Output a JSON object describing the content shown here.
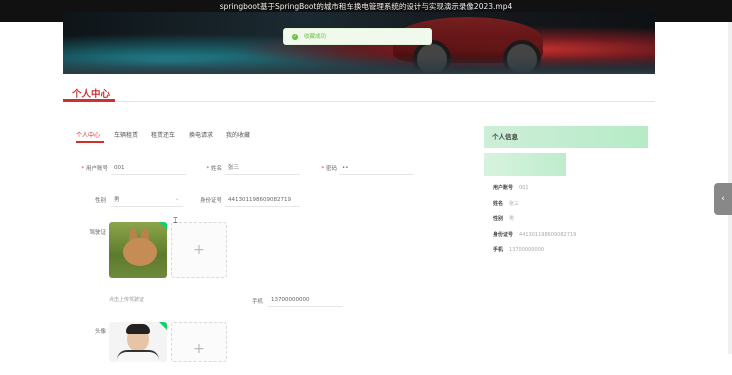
{
  "video_title": "springboot基于SpringBoot的城市租车换电管理系统的设计与实现演示录像2023.mp4",
  "toast": {
    "message": "收藏成功"
  },
  "section_title": "个人中心",
  "tabs": [
    {
      "label": "个人中心",
      "active": true
    },
    {
      "label": "车辆租赁",
      "active": false
    },
    {
      "label": "租赁还车",
      "active": false
    },
    {
      "label": "换电请求",
      "active": false
    },
    {
      "label": "我的收藏",
      "active": false
    }
  ],
  "form": {
    "account_label": "用户账号",
    "account_value": "001",
    "name_label": "姓名",
    "name_value": "张三",
    "password_label": "密码",
    "password_value": "••",
    "gender_label": "性别",
    "gender_value": "男",
    "idcard_label": "身份证号",
    "idcard_value": "441301198609082719",
    "license_label": "驾驶证",
    "license_hint": "点击上传驾驶证",
    "phone_label": "手机",
    "phone_value": "13700000000",
    "avatar_label": "头像",
    "plus_symbol": "+"
  },
  "panel": {
    "title": "个人信息",
    "rows": [
      {
        "key": "用户账号",
        "value": "001"
      },
      {
        "key": "姓名",
        "value": "张三"
      },
      {
        "key": "性别",
        "value": "男"
      },
      {
        "key": "身份证号",
        "value": "441301198609082719"
      },
      {
        "key": "手机",
        "value": "13700000000"
      }
    ]
  },
  "colors": {
    "accent": "#d03030",
    "success": "#67c23a",
    "panel_green": "#cdeed8"
  },
  "icons": {
    "toast": "check-circle-icon",
    "side": "chevron-left-icon",
    "select": "chevron-down-icon"
  }
}
